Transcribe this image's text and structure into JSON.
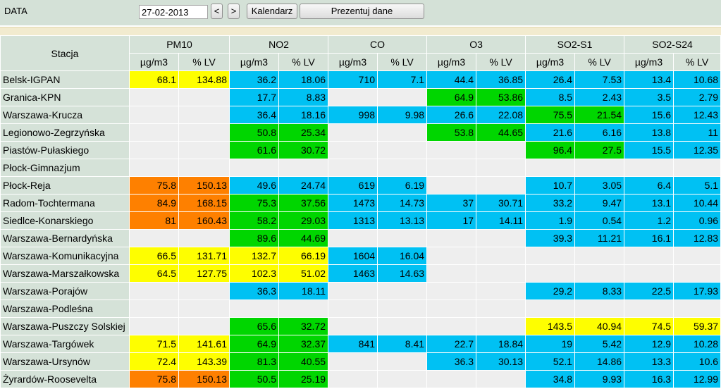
{
  "toolbar": {
    "date_label": "DATA",
    "date_value": "27-02-2013",
    "prev_label": "<",
    "next_label": ">",
    "calendar_label": "Kalendarz",
    "show_label": "Prezentuj dane"
  },
  "colors": {
    "none": "#eeeeee",
    "blue": "#00c1f3",
    "green": "#00d600",
    "yellow": "#fefe00",
    "orange": "#fe8000",
    "header": "#d5e2d8"
  },
  "table": {
    "station_header": "Stacja",
    "groups": [
      "PM10",
      "NO2",
      "CO",
      "O3",
      "SO2-S1",
      "SO2-S24"
    ],
    "units": [
      "µg/m3",
      "% LV"
    ],
    "rows": [
      {
        "station": "Belsk-IGPAN",
        "cells": [
          [
            "68.1",
            "134.88",
            "yellow"
          ],
          [
            "36.2",
            "18.06",
            "blue"
          ],
          [
            "710",
            "7.1",
            "blue"
          ],
          [
            "44.4",
            "36.85",
            "blue"
          ],
          [
            "26.4",
            "7.53",
            "blue"
          ],
          [
            "13.4",
            "10.68",
            "blue"
          ]
        ]
      },
      {
        "station": "Granica-KPN",
        "cells": [
          [
            "",
            "",
            "none"
          ],
          [
            "17.7",
            "8.83",
            "blue"
          ],
          [
            "",
            "",
            "none"
          ],
          [
            "64.9",
            "53.86",
            "green"
          ],
          [
            "8.5",
            "2.43",
            "blue"
          ],
          [
            "3.5",
            "2.79",
            "blue"
          ]
        ]
      },
      {
        "station": "Warszawa-Krucza",
        "cells": [
          [
            "",
            "",
            "none"
          ],
          [
            "36.4",
            "18.16",
            "blue"
          ],
          [
            "998",
            "9.98",
            "blue"
          ],
          [
            "26.6",
            "22.08",
            "blue"
          ],
          [
            "75.5",
            "21.54",
            "green"
          ],
          [
            "15.6",
            "12.43",
            "blue"
          ]
        ]
      },
      {
        "station": "Legionowo-Zegrzyńska",
        "cells": [
          [
            "",
            "",
            "none"
          ],
          [
            "50.8",
            "25.34",
            "green"
          ],
          [
            "",
            "",
            "none"
          ],
          [
            "53.8",
            "44.65",
            "green"
          ],
          [
            "21.6",
            "6.16",
            "blue"
          ],
          [
            "13.8",
            "11",
            "blue"
          ]
        ]
      },
      {
        "station": "Piastów-Pułaskiego",
        "cells": [
          [
            "",
            "",
            "none"
          ],
          [
            "61.6",
            "30.72",
            "green"
          ],
          [
            "",
            "",
            "none"
          ],
          [
            "",
            "",
            "none"
          ],
          [
            "96.4",
            "27.5",
            "green"
          ],
          [
            "15.5",
            "12.35",
            "blue"
          ]
        ]
      },
      {
        "station": "Płock-Gimnazjum",
        "cells": [
          [
            "",
            "",
            "none"
          ],
          [
            "",
            "",
            "none"
          ],
          [
            "",
            "",
            "none"
          ],
          [
            "",
            "",
            "none"
          ],
          [
            "",
            "",
            "none"
          ],
          [
            "",
            "",
            "none"
          ]
        ]
      },
      {
        "station": "Płock-Reja",
        "cells": [
          [
            "75.8",
            "150.13",
            "orange"
          ],
          [
            "49.6",
            "24.74",
            "blue"
          ],
          [
            "619",
            "6.19",
            "blue"
          ],
          [
            "",
            "",
            "none"
          ],
          [
            "10.7",
            "3.05",
            "blue"
          ],
          [
            "6.4",
            "5.1",
            "blue"
          ]
        ]
      },
      {
        "station": "Radom-Tochtermana",
        "cells": [
          [
            "84.9",
            "168.15",
            "orange"
          ],
          [
            "75.3",
            "37.56",
            "green"
          ],
          [
            "1473",
            "14.73",
            "blue"
          ],
          [
            "37",
            "30.71",
            "blue"
          ],
          [
            "33.2",
            "9.47",
            "blue"
          ],
          [
            "13.1",
            "10.44",
            "blue"
          ]
        ]
      },
      {
        "station": "Siedlce-Konarskiego",
        "cells": [
          [
            "81",
            "160.43",
            "orange"
          ],
          [
            "58.2",
            "29.03",
            "green"
          ],
          [
            "1313",
            "13.13",
            "blue"
          ],
          [
            "17",
            "14.11",
            "blue"
          ],
          [
            "1.9",
            "0.54",
            "blue"
          ],
          [
            "1.2",
            "0.96",
            "blue"
          ]
        ]
      },
      {
        "station": "Warszawa-Bernardyńska",
        "cells": [
          [
            "",
            "",
            "none"
          ],
          [
            "89.6",
            "44.69",
            "green"
          ],
          [
            "",
            "",
            "none"
          ],
          [
            "",
            "",
            "none"
          ],
          [
            "39.3",
            "11.21",
            "blue"
          ],
          [
            "16.1",
            "12.83",
            "blue"
          ]
        ]
      },
      {
        "station": "Warszawa-Komunikacyjna",
        "cells": [
          [
            "66.5",
            "131.71",
            "yellow"
          ],
          [
            "132.7",
            "66.19",
            "yellow"
          ],
          [
            "1604",
            "16.04",
            "blue"
          ],
          [
            "",
            "",
            "none"
          ],
          [
            "",
            "",
            "none"
          ],
          [
            "",
            "",
            "none"
          ]
        ]
      },
      {
        "station": "Warszawa-Marszałkowska",
        "cells": [
          [
            "64.5",
            "127.75",
            "yellow"
          ],
          [
            "102.3",
            "51.02",
            "yellow"
          ],
          [
            "1463",
            "14.63",
            "blue"
          ],
          [
            "",
            "",
            "none"
          ],
          [
            "",
            "",
            "none"
          ],
          [
            "",
            "",
            "none"
          ]
        ]
      },
      {
        "station": "Warszawa-Porajów",
        "cells": [
          [
            "",
            "",
            "none"
          ],
          [
            "36.3",
            "18.11",
            "blue"
          ],
          [
            "",
            "",
            "none"
          ],
          [
            "",
            "",
            "none"
          ],
          [
            "29.2",
            "8.33",
            "blue"
          ],
          [
            "22.5",
            "17.93",
            "blue"
          ]
        ]
      },
      {
        "station": "Warszawa-Podleśna",
        "cells": [
          [
            "",
            "",
            "none"
          ],
          [
            "",
            "",
            "none"
          ],
          [
            "",
            "",
            "none"
          ],
          [
            "",
            "",
            "none"
          ],
          [
            "",
            "",
            "none"
          ],
          [
            "",
            "",
            "none"
          ]
        ]
      },
      {
        "station": "Warszawa-Puszczy Solskiej",
        "cells": [
          [
            "",
            "",
            "none"
          ],
          [
            "65.6",
            "32.72",
            "green"
          ],
          [
            "",
            "",
            "none"
          ],
          [
            "",
            "",
            "none"
          ],
          [
            "143.5",
            "40.94",
            "yellow"
          ],
          [
            "74.5",
            "59.37",
            "yellow"
          ]
        ]
      },
      {
        "station": "Warszawa-Targówek",
        "cells": [
          [
            "71.5",
            "141.61",
            "yellow"
          ],
          [
            "64.9",
            "32.37",
            "green"
          ],
          [
            "841",
            "8.41",
            "blue"
          ],
          [
            "22.7",
            "18.84",
            "blue"
          ],
          [
            "19",
            "5.42",
            "blue"
          ],
          [
            "12.9",
            "10.28",
            "blue"
          ]
        ]
      },
      {
        "station": "Warszawa-Ursynów",
        "cells": [
          [
            "72.4",
            "143.39",
            "yellow"
          ],
          [
            "81.3",
            "40.55",
            "green"
          ],
          [
            "",
            "",
            "none"
          ],
          [
            "36.3",
            "30.13",
            "blue"
          ],
          [
            "52.1",
            "14.86",
            "blue"
          ],
          [
            "13.3",
            "10.6",
            "blue"
          ]
        ]
      },
      {
        "station": "Żyrardów-Roosevelta",
        "cells": [
          [
            "75.8",
            "150.13",
            "orange"
          ],
          [
            "50.5",
            "25.19",
            "green"
          ],
          [
            "",
            "",
            "none"
          ],
          [
            "",
            "",
            "none"
          ],
          [
            "34.8",
            "9.93",
            "blue"
          ],
          [
            "16.3",
            "12.99",
            "blue"
          ]
        ]
      }
    ]
  }
}
